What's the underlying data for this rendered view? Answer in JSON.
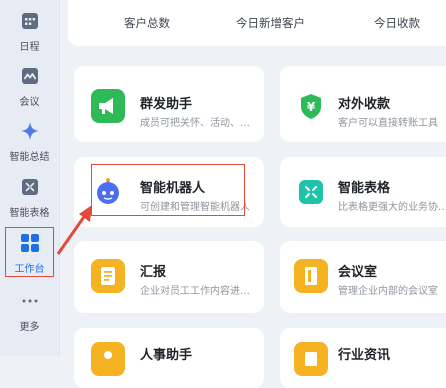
{
  "sidebar": {
    "items": [
      {
        "label": "日程",
        "icon": "calendar-icon"
      },
      {
        "label": "会议",
        "icon": "meeting-icon"
      },
      {
        "label": "智能总结",
        "icon": "sparkle-icon"
      },
      {
        "label": "智能表格",
        "icon": "smart-sheet-icon"
      },
      {
        "label": "工作台",
        "icon": "grid-icon",
        "active": true
      },
      {
        "label": "更多",
        "icon": "more-dots-icon"
      }
    ]
  },
  "stats": {
    "labels": [
      "客户总数",
      "今日新增客户",
      "今日收款"
    ]
  },
  "apps": [
    {
      "title": "群发助手",
      "desc": "成员可把关怀、活动、通知群发给客户",
      "icon": "megaphone-icon",
      "color": "#2fba5a"
    },
    {
      "title": "对外收款",
      "desc": "客户可以直接转账工具",
      "icon": "yuan-shield-icon",
      "color": "#2fba5a"
    },
    {
      "title": "智能机器人",
      "desc": "可创建和管理智能机器人",
      "icon": "robot-icon",
      "color": "#4e6ef2"
    },
    {
      "title": "智能表格",
      "desc": "比表格更强大的业务协作工具",
      "icon": "smart-sheet-icon",
      "color": "#1fc4a8"
    },
    {
      "title": "汇报",
      "desc": "企业对员工工作内容进行汇报",
      "icon": "report-icon",
      "color": "#f5b324"
    },
    {
      "title": "会议室",
      "desc": "管理企业内部的会议室",
      "icon": "meeting-room-icon",
      "color": "#f5b324"
    },
    {
      "title": "人事助手",
      "desc": "",
      "icon": "hr-icon",
      "color": "#f5b324"
    },
    {
      "title": "行业资讯",
      "desc": "",
      "icon": "news-icon",
      "color": "#f5b324"
    }
  ],
  "colors": {
    "accent": "#1f6fe5",
    "highlight": "#e34a3a"
  }
}
